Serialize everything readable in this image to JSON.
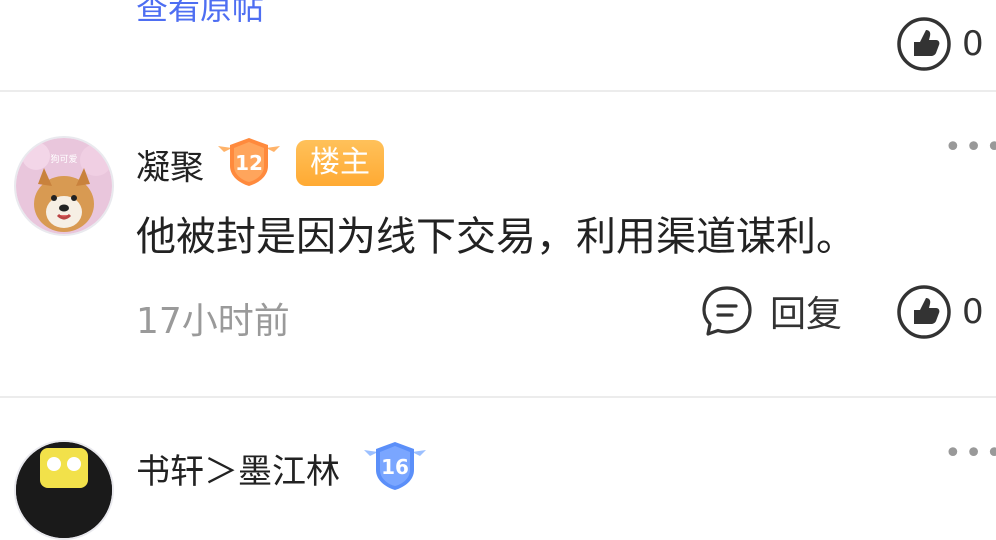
{
  "previous": {
    "view_original": "查看原帖",
    "like_count": "0"
  },
  "comment": {
    "username": "凝聚",
    "level": "12",
    "op_badge": "楼主",
    "text": "他被封是因为线下交易，利用渠道谋利。",
    "time": "17小时前",
    "reply_label": "回复",
    "like_count": "0",
    "avatar_caption": "狗可爱"
  },
  "next": {
    "username": "书轩＞墨江林",
    "level": "16"
  },
  "colors": {
    "link": "#4e6ef2",
    "op_badge": "#ffb340",
    "level_badge": "#ff8a3d",
    "level_badge_next": "#5b8ff9"
  }
}
